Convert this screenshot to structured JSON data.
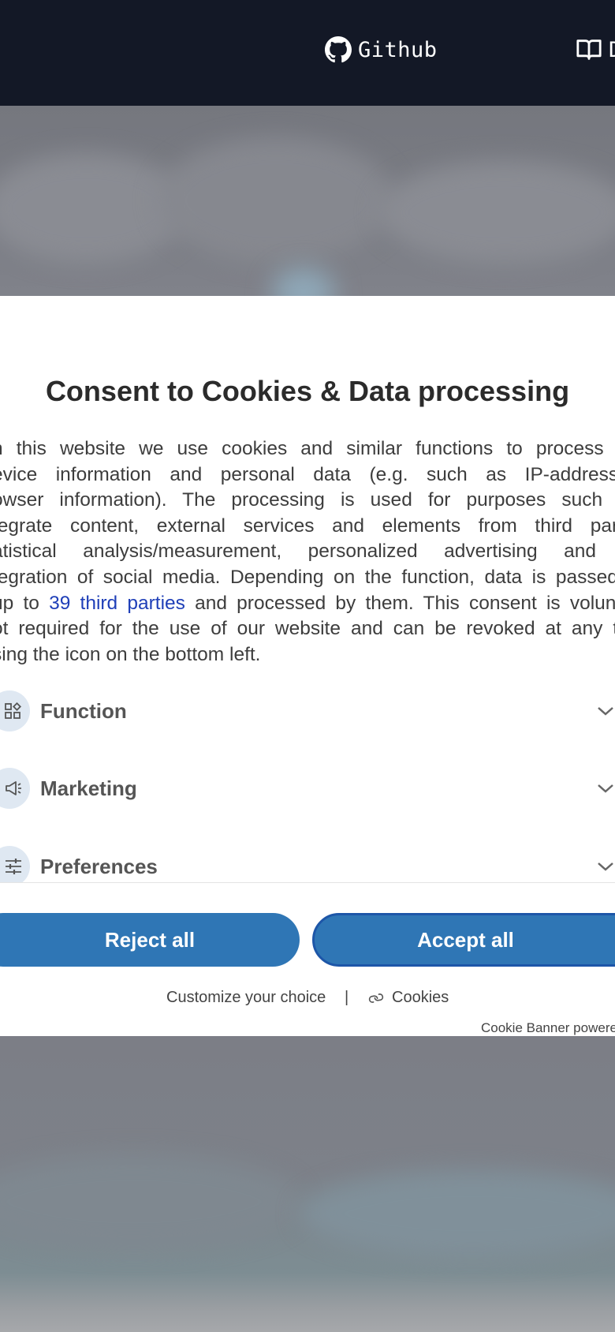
{
  "nav": {
    "github_label": "Github",
    "docs_label": "D",
    "icons": [
      "github-icon",
      "book-icon"
    ],
    "background_color": "#131826"
  },
  "modal": {
    "title": "Consent to Cookies & Data processing",
    "body_lines": [
      "n this website we use cookies and similar functions to process en",
      "evice information and personal data (e.g. such as IP-addresses",
      "owser information). The processing is used for purposes such as",
      "tegrate content, external services and elements from third partie",
      "atistical analysis/measurement, personalized advertising and th",
      "tegration of social media. Depending on the function, data is passed o"
    ],
    "body_line7_prefix": " up to ",
    "third_parties_link": "39 third parties",
    "body_line7_suffix": " and processed by them. This consent is voluntar",
    "body_line8": "ot required for the use of our website and can be revoked at any tim",
    "body_line9": "sing the icon on the bottom left.",
    "categories": [
      {
        "label": "Function",
        "icon": "function-grid-icon"
      },
      {
        "label": "Marketing",
        "icon": "megaphone-icon"
      },
      {
        "label": "Preferences",
        "icon": "sliders-icon"
      }
    ],
    "reject_label": "Reject all",
    "accept_label": "Accept all",
    "customize_label": "Customize your choice",
    "separator": "|",
    "cookies_label": "Cookies",
    "powered_label": "Cookie Banner powere",
    "button_color": "#2f76b5",
    "link_color": "#1f3fb8"
  }
}
